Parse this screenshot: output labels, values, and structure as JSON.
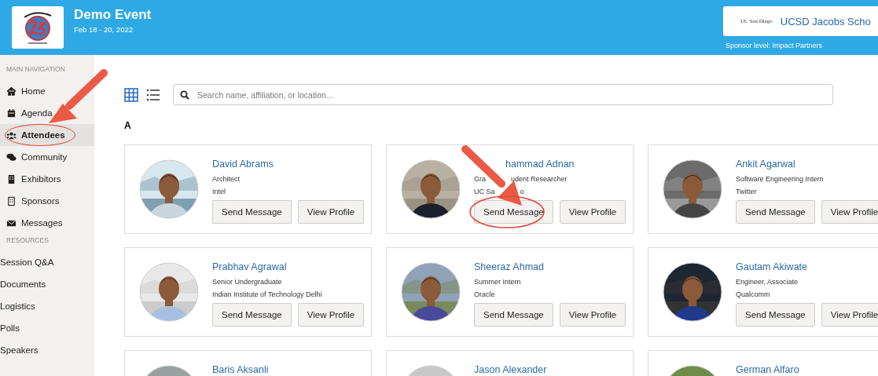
{
  "event": {
    "title": "Demo Event",
    "dates": "Feb 18 - 20, 2022"
  },
  "sponsor": {
    "logo_text": "UC San Diego",
    "name": "UCSD Jacobs Scho",
    "level": "Sponsor level: Impact Partners"
  },
  "sidebar": {
    "sections": [
      {
        "heading": "MAIN NAVIGATION",
        "items": [
          {
            "label": "Home",
            "selected": false
          },
          {
            "label": "Agenda",
            "selected": false
          },
          {
            "label": "Attendees",
            "selected": true
          },
          {
            "label": "Community",
            "selected": false
          },
          {
            "label": "Exhibitors",
            "selected": false
          },
          {
            "label": "Sponsors",
            "selected": false
          },
          {
            "label": "Messages",
            "selected": false
          }
        ]
      },
      {
        "heading": "RESOURCES",
        "items": [
          {
            "label": "Session Q&A",
            "selected": false
          },
          {
            "label": "Documents",
            "selected": false
          },
          {
            "label": "Logistics",
            "selected": false
          },
          {
            "label": "Polls",
            "selected": false
          },
          {
            "label": "Speakers",
            "selected": false
          }
        ]
      }
    ]
  },
  "views": [
    {
      "kind": "grid",
      "selected": true
    },
    {
      "kind": "list",
      "selected": false
    }
  ],
  "search": {
    "placeholder": "Search name, affiliation, or location..."
  },
  "group_letter": "A",
  "attendees": [
    {
      "name": "David Abrams",
      "title": [
        "Architect"
      ],
      "org": [
        "Intel"
      ],
      "buttons": [
        "Send Message",
        "View Profile"
      ]
    },
    {
      "name": "hammad Adnan",
      "title": [
        "Gra",
        "udent Researcher"
      ],
      "org": [
        "UC Sa",
        "o"
      ],
      "buttons": [
        "Send Message",
        "View Profile"
      ],
      "annotated": true
    },
    {
      "name": "Ankit Agarwal",
      "title": [
        "Software Engineering Intern"
      ],
      "org": [
        "Twitter"
      ],
      "buttons": [
        "Send Message",
        "View Profile"
      ]
    },
    {
      "name": "Prabhav Agrawal",
      "title": [
        "Senior Undergraduate"
      ],
      "org": [
        "Indian Institute of Technology Delhi"
      ],
      "buttons": [
        "Send Message",
        "View Profile"
      ]
    },
    {
      "name": "Sheeraz Ahmad",
      "title": [
        "Summer Intern"
      ],
      "org": [
        "Oracle"
      ],
      "buttons": [
        "Send Message",
        "View Profile"
      ]
    },
    {
      "name": "Gautam Akiwate",
      "title": [
        "Engineer, Associate"
      ],
      "org": [
        "Qualcomm"
      ],
      "buttons": [
        "Send Message",
        "View Profile"
      ]
    },
    {
      "name": "Baris Aksanli"
    },
    {
      "name": "Jason Alexander"
    },
    {
      "name": "German Alfaro"
    }
  ]
}
